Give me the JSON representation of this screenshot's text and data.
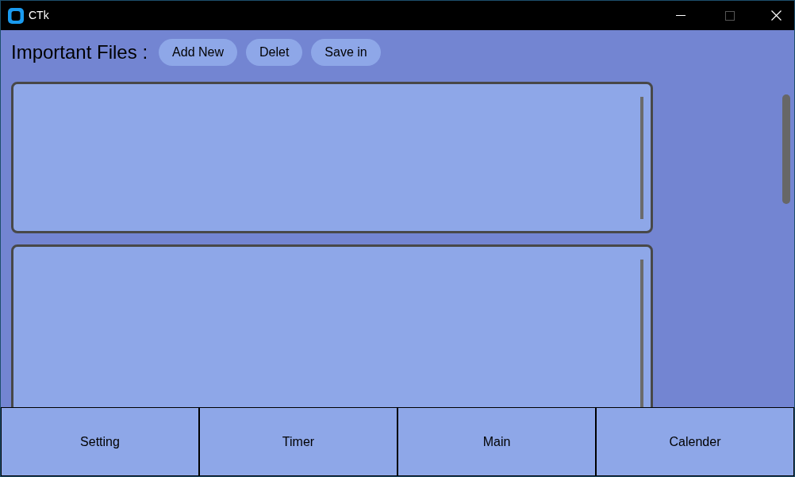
{
  "window": {
    "title": "CTk"
  },
  "header": {
    "title": "Important Files :",
    "buttons": [
      "Add New",
      "Delet",
      "Save in"
    ]
  },
  "text_areas": [
    {
      "kind": "textbox"
    },
    {
      "kind": "textbox"
    }
  ],
  "nav_buttons": [
    "Setting",
    "Timer",
    "Main",
    "Calender"
  ]
}
